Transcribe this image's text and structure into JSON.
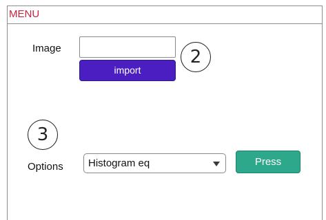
{
  "menu": {
    "label": "MENU",
    "color": "#c4223f"
  },
  "image_section": {
    "label": "Image",
    "field_value": "",
    "import_label": "import",
    "import_color": "#4a1ec0",
    "step_marker": "2"
  },
  "options_section": {
    "label": "Options",
    "selected": "Histogram eq",
    "press_label": "Press",
    "press_color": "#2ea88a",
    "step_marker": "3",
    "caret_icon": "caret-down-icon"
  }
}
